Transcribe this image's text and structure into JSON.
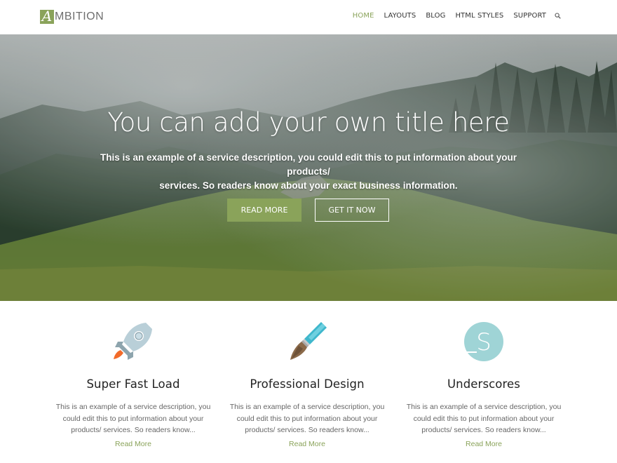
{
  "brand": {
    "logo_letter": "A",
    "logo_rest": "MBITION",
    "accent_color": "#8aa35a"
  },
  "nav": {
    "items": [
      {
        "label": "HOME",
        "active": true
      },
      {
        "label": "LAYOUTS",
        "active": false
      },
      {
        "label": "BLOG",
        "active": false
      },
      {
        "label": "HTML STYLES",
        "active": false
      },
      {
        "label": "SUPPORT",
        "active": false
      }
    ],
    "search_icon": "search-icon"
  },
  "hero": {
    "title": "You can add your own title here",
    "description_line1": "This is an example of a service description, you could edit this to put information about your products/",
    "description_line2": "services. So readers know about your exact business information.",
    "primary_button": "READ MORE",
    "secondary_button": "GET IT NOW"
  },
  "features": [
    {
      "icon": "rocket-icon",
      "title": "Super Fast Load",
      "desc_line1": "This is an example of a service description, you",
      "desc_line2": "could edit this to put information about your",
      "desc_line3": "products/ services. So readers know...",
      "link": "Read More"
    },
    {
      "icon": "paintbrush-icon",
      "title": "Professional Design",
      "desc_line1": "This is an example of a service description, you",
      "desc_line2": "could edit this to put information about your",
      "desc_line3": "products/ services. So readers know...",
      "link": "Read More"
    },
    {
      "icon": "underscores-logo-icon",
      "title": "Underscores",
      "desc_line1": "This is an example of a service description, you",
      "desc_line2": "could edit this to put information about your",
      "desc_line3": "products/ services. So readers know...",
      "link": "Read More"
    }
  ]
}
